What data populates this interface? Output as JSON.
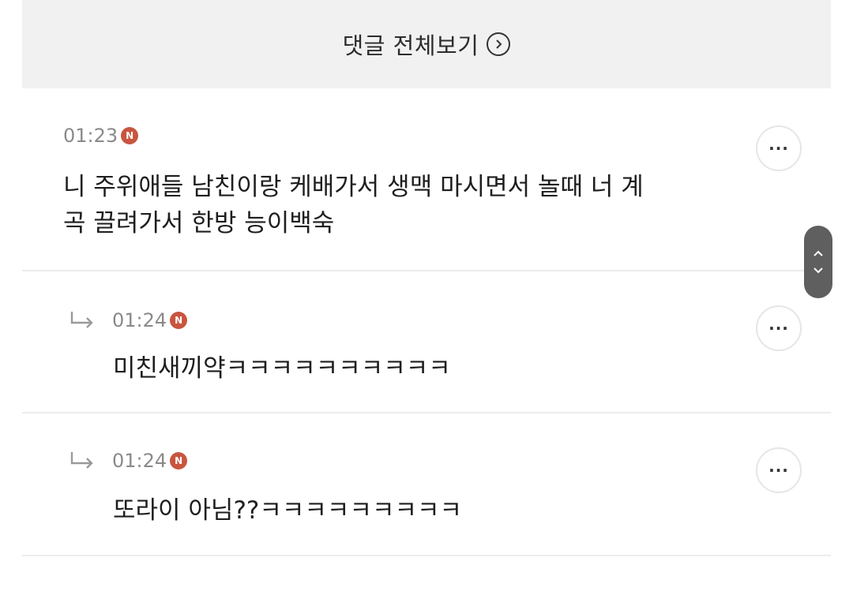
{
  "header": {
    "title": "댓글 전체보기",
    "arrow_icon": "chevron-right-circle-icon"
  },
  "comments": [
    {
      "time": "01:23",
      "badge": "N",
      "text_line1": "니 주위애들 남친이랑 케배가서 생맥 마시면서 놀때 너 계",
      "text_line2": "곡 끌려가서 한방 능이백숙",
      "more": "···"
    },
    {
      "reply": true,
      "time": "01:24",
      "badge": "N",
      "text": "미친새끼약ㅋㅋㅋㅋㅋㅋㅋㅋㅋㅋ",
      "more": "···"
    },
    {
      "reply": true,
      "time": "01:24",
      "badge": "N",
      "text": "또라이 아님??ㅋㅋㅋㅋㅋㅋㅋㅋㅋ",
      "more": "···"
    }
  ],
  "colors": {
    "badge": "#c8553f",
    "header_bg": "#f1f1f1",
    "scroll_handle": "#5f5f5f"
  }
}
